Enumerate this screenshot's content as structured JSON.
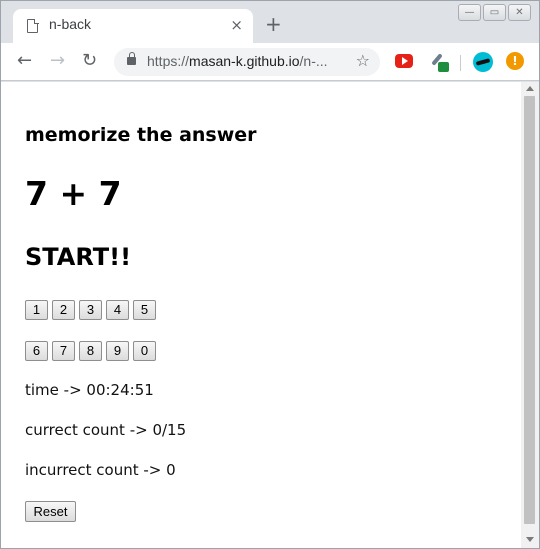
{
  "browser": {
    "tab": {
      "title": "n-back",
      "close_icon": "×"
    },
    "new_tab_icon": "+",
    "window_controls": [
      "—",
      "▭",
      "✕"
    ],
    "nav": {
      "back_icon": "←",
      "forward_icon": "→",
      "reload_icon": "↻"
    },
    "url": {
      "scheme": "https://",
      "host": "masan-k.github.io",
      "rest": "/n-..."
    },
    "bookmark_icon": "☆",
    "extensions": [
      "youtube-icon",
      "color-picker-icon",
      "avatar-icon",
      "alert-icon"
    ],
    "alert_glyph": "!"
  },
  "page": {
    "instruction": "memorize the answer",
    "question": "7 + 7",
    "status": "START!!",
    "keypad": {
      "row1": [
        "1",
        "2",
        "3",
        "4",
        "5"
      ],
      "row2": [
        "6",
        "7",
        "8",
        "9",
        "0"
      ]
    },
    "time_text": "time -> 00:24:51",
    "correct_text": "currect count -> 0/15",
    "incorrect_text": "incurrect count -> 0",
    "reset_label": "Reset"
  }
}
